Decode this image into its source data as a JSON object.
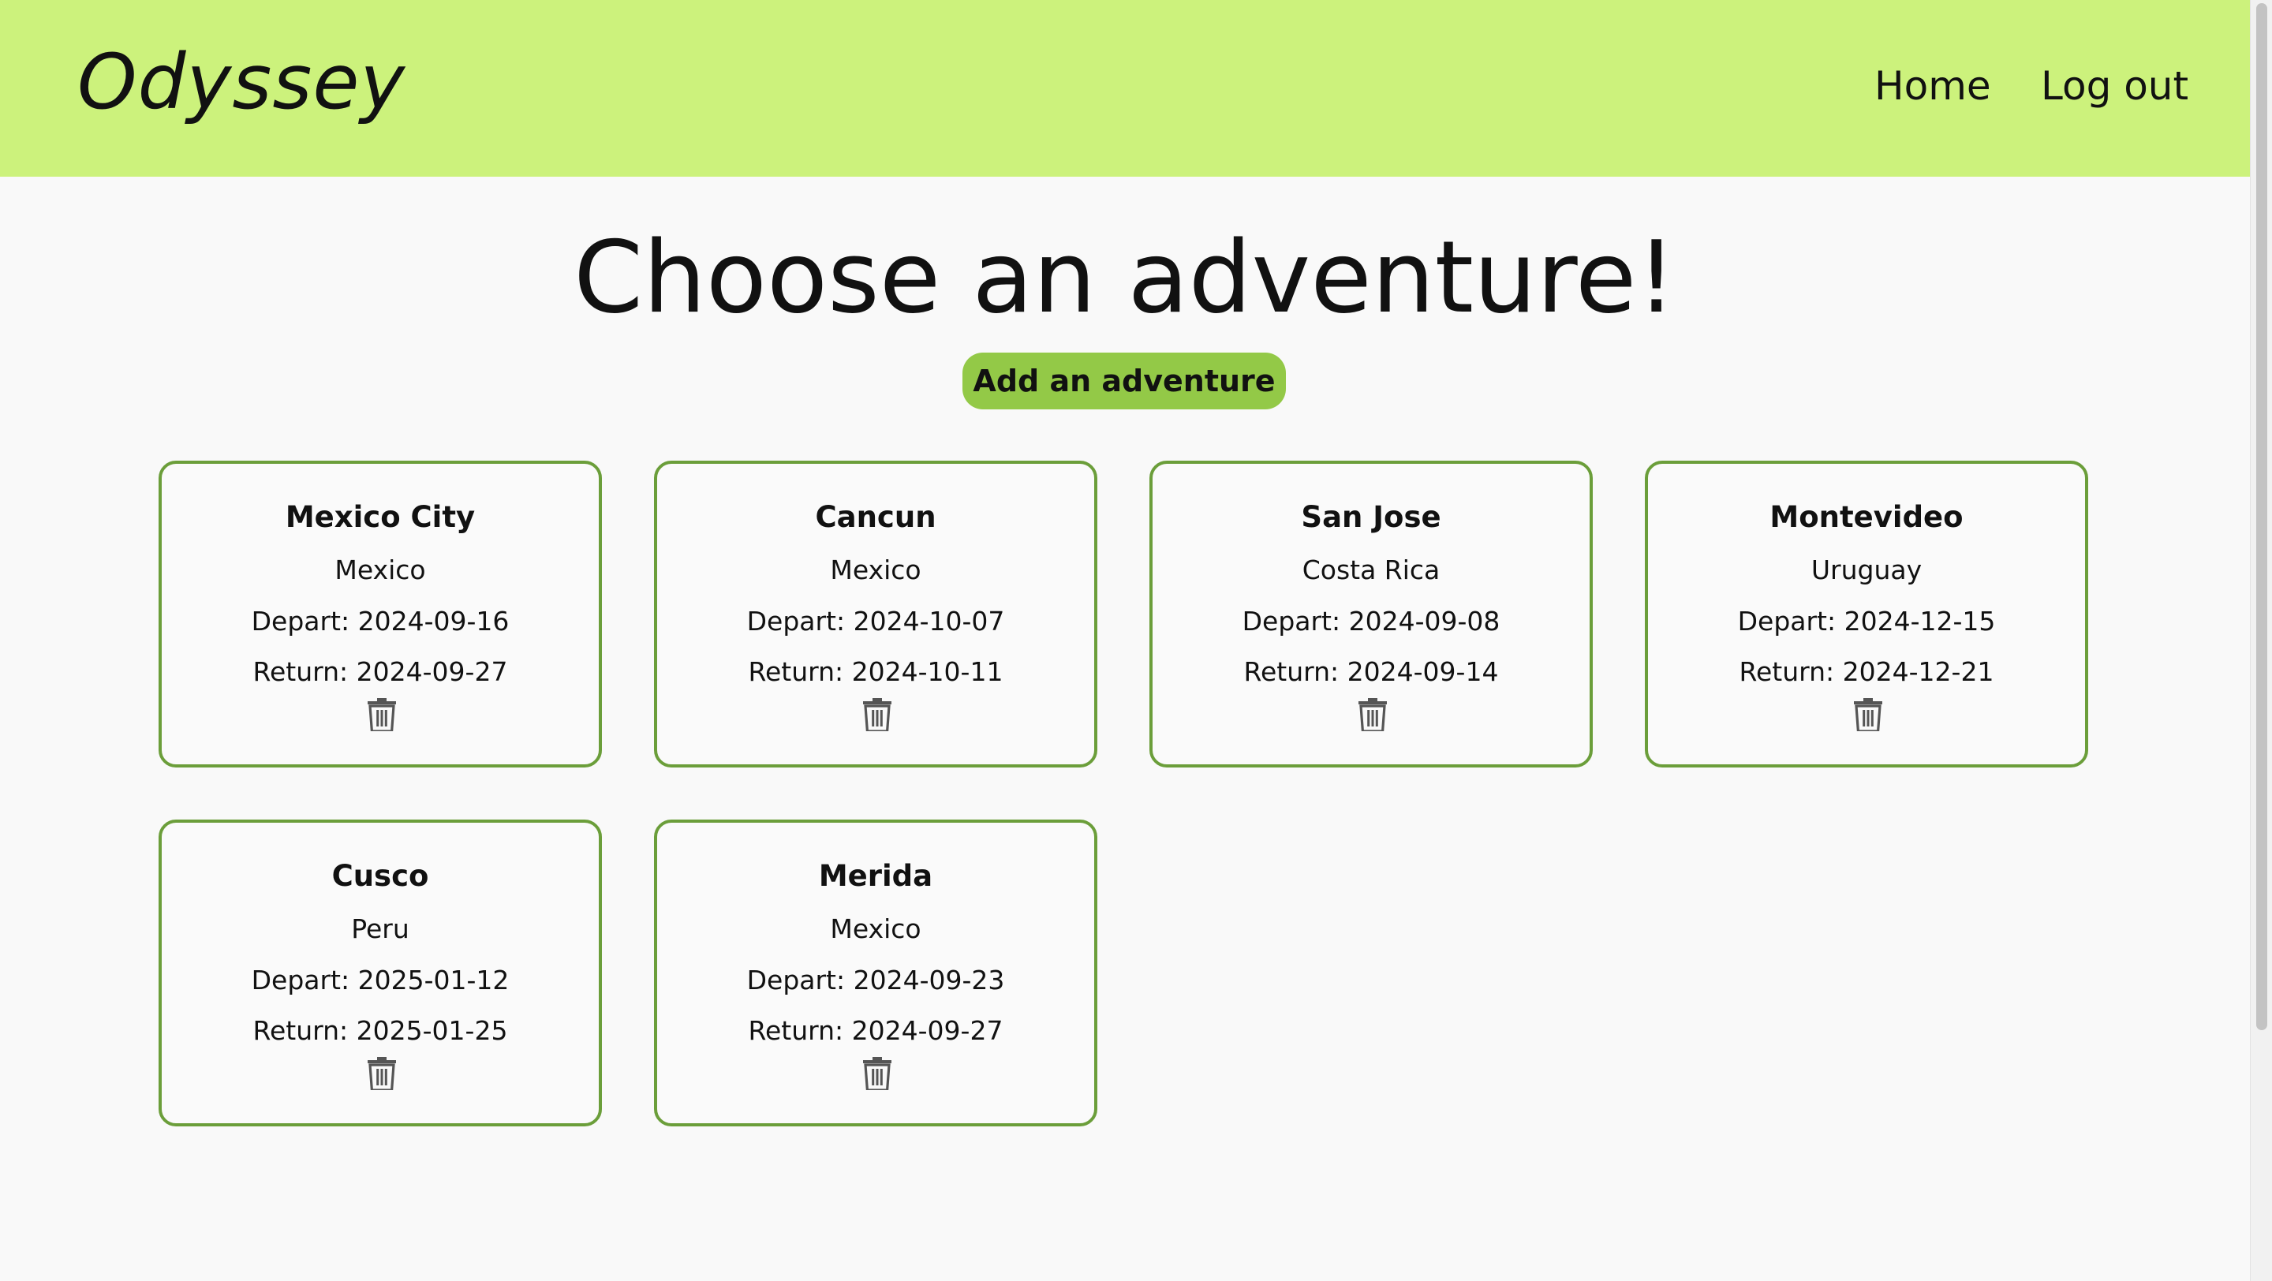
{
  "header": {
    "brand": "Odyssey",
    "nav": {
      "home": "Home",
      "logout": "Log out"
    },
    "background_color": "#ccf27c"
  },
  "main": {
    "heading": "Choose an adventure!",
    "add_button_label": "Add an adventure",
    "accent_color": "#93c947",
    "card_border_color": "#6b9e3a"
  },
  "adventures": [
    {
      "city": "Mexico City",
      "country": "Mexico",
      "depart": "Depart: 2024-09-16",
      "return": "Return: 2024-09-27",
      "action_icon": "trash-icon"
    },
    {
      "city": "Cancun",
      "country": "Mexico",
      "depart": "Depart: 2024-10-07",
      "return": "Return: 2024-10-11",
      "action_icon": "trash-icon"
    },
    {
      "city": "San Jose",
      "country": "Costa Rica",
      "depart": "Depart: 2024-09-08",
      "return": "Return: 2024-09-14",
      "action_icon": "trash-icon"
    },
    {
      "city": "Montevideo",
      "country": "Uruguay",
      "depart": "Depart: 2024-12-15",
      "return": "Return: 2024-12-21",
      "action_icon": "trash-icon"
    },
    {
      "city": "Cusco",
      "country": "Peru",
      "depart": "Depart: 2025-01-12",
      "return": "Return: 2025-01-25",
      "action_icon": "trash-icon"
    },
    {
      "city": "Merida",
      "country": "Mexico",
      "depart": "Depart: 2024-09-23",
      "return": "Return: 2024-09-27",
      "action_icon": "trash-icon"
    }
  ]
}
